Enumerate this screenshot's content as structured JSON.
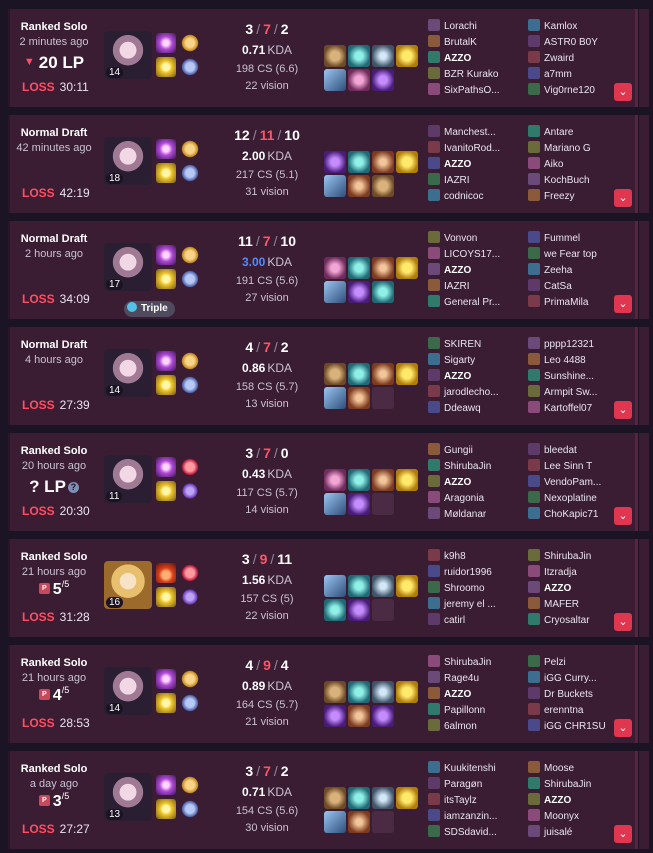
{
  "matches": [
    {
      "mode": "Ranked Solo",
      "ago": "2 minutes ago",
      "lp": {
        "kind": "change",
        "arrow": "▼",
        "text": "20 LP"
      },
      "result": "LOSS",
      "duration": "30:11",
      "champion": {
        "icon": "irelia-portrait-icon",
        "level": "14"
      },
      "spells": [
        "teleport-icon",
        "flash-icon"
      ],
      "runes": [
        "conqueror-icon",
        "resolve-tree-icon"
      ],
      "kills": "3",
      "deaths": "7",
      "assists": "2",
      "kda": "0.71",
      "kda_label": "KDA",
      "kda_color": "#ffffff",
      "cs": "198 CS (6.6)",
      "vision": "22 vision",
      "items": [
        "c0",
        "c1",
        "c2",
        "c3",
        "c4",
        "c5",
        "c6",
        "empty"
      ],
      "team1": [
        "Lorachi",
        "BrutalK",
        "AZZO",
        "BZR Kurako",
        "SixPathsO..."
      ],
      "team2": [
        "Kamlox",
        "ASTR0 B0Y",
        "Zwaird",
        "a7mm",
        "Vig0rne120"
      ]
    },
    {
      "mode": "Normal Draft",
      "ago": "42 minutes ago",
      "lp": {
        "kind": "none"
      },
      "result": "LOSS",
      "duration": "42:19",
      "champion": {
        "icon": "irelia-portrait-icon",
        "level": "18"
      },
      "spells": [
        "teleport-icon",
        "flash-icon"
      ],
      "runes": [
        "conqueror-icon",
        "resolve-tree-icon"
      ],
      "kills": "12",
      "deaths": "11",
      "assists": "10",
      "kda": "2.00",
      "kda_label": "KDA",
      "kda_color": "#ffffff",
      "cs": "217 CS (5.1)",
      "vision": "31 vision",
      "items": [
        "c6",
        "c1",
        "c7",
        "c3",
        "c4",
        "c7",
        "c0",
        "empty"
      ],
      "team1": [
        "Manchest...",
        "IvanitoRod...",
        "AZZO",
        "IAZRI",
        "codnicoc"
      ],
      "team2": [
        "Antare",
        "Mariano G",
        "Aiko",
        "KochBuch",
        "Freezy"
      ]
    },
    {
      "mode": "Normal Draft",
      "ago": "2 hours ago",
      "lp": {
        "kind": "none"
      },
      "multikill": "Triple",
      "result": "LOSS",
      "duration": "34:09",
      "champion": {
        "icon": "irelia-portrait-icon",
        "level": "17"
      },
      "spells": [
        "teleport-icon",
        "flash-icon"
      ],
      "runes": [
        "conqueror-icon",
        "resolve-tree-icon"
      ],
      "kills": "11",
      "deaths": "7",
      "assists": "10",
      "kda": "3.00",
      "kda_label": "KDA",
      "kda_color": "#4f8cff",
      "cs": "191 CS (5.6)",
      "vision": "27 vision",
      "items": [
        "c5",
        "c1",
        "c7",
        "c3",
        "c4",
        "c6",
        "c1",
        "empty"
      ],
      "team1": [
        "Vonvon",
        "LICOYS17...",
        "AZZO",
        "IAZRI",
        "General Pr..."
      ],
      "team2": [
        "Fummel",
        "we Fear top",
        "Zeeha",
        "CatSa",
        "PrimaMila"
      ]
    },
    {
      "mode": "Normal Draft",
      "ago": "4 hours ago",
      "lp": {
        "kind": "none"
      },
      "result": "LOSS",
      "duration": "27:39",
      "champion": {
        "icon": "irelia-portrait-icon",
        "level": "14"
      },
      "spells": [
        "teleport-icon",
        "flash-icon"
      ],
      "runes": [
        "conqueror-icon",
        "resolve-tree-icon"
      ],
      "kills": "4",
      "deaths": "7",
      "assists": "2",
      "kda": "0.86",
      "kda_label": "KDA",
      "kda_color": "#ffffff",
      "cs": "158 CS (5.7)",
      "vision": "13 vision",
      "items": [
        "c0",
        "c1",
        "c7",
        "c3",
        "c4",
        "c7",
        "empty",
        "empty"
      ],
      "team1": [
        "SKIREN",
        "Sigarty",
        "AZZO",
        "jarodlecho...",
        "Ddeawq"
      ],
      "team2": [
        "pppp12321",
        "Leo 4488",
        "Sunshine...",
        "Armpit Sw...",
        "Kartoffel07"
      ]
    },
    {
      "mode": "Ranked Solo",
      "ago": "20 hours ago",
      "lp": {
        "kind": "unknown",
        "text": "? LP",
        "icon": "?"
      },
      "result": "LOSS",
      "duration": "20:30",
      "champion": {
        "icon": "irelia-portrait-icon",
        "level": "11"
      },
      "spells": [
        "teleport-icon",
        "flash-icon"
      ],
      "runes": [
        "electrocute-icon",
        "domination-tree-icon"
      ],
      "kills": "3",
      "deaths": "7",
      "assists": "0",
      "kda": "0.43",
      "kda_label": "KDA",
      "kda_color": "#ffffff",
      "cs": "117 CS (5.7)",
      "vision": "14 vision",
      "items": [
        "c5",
        "c1",
        "c7",
        "c3",
        "c4",
        "c6",
        "empty",
        "empty"
      ],
      "team1": [
        "Gungii",
        "ShirubaJin",
        "AZZO",
        "Aragonia",
        "Møldanar"
      ],
      "team2": [
        "bleedat",
        "Lee Sinn T",
        "VendoPam...",
        "Nexoplatine",
        "ChoKapic71"
      ]
    },
    {
      "mode": "Ranked Solo",
      "ago": "21 hours ago",
      "lp": {
        "kind": "promo",
        "badge": "P",
        "num": "5",
        "den": "/5"
      },
      "result": "LOSS",
      "duration": "31:28",
      "champion": {
        "icon": "lux-portrait-icon",
        "level": "16"
      },
      "spells": [
        "ignite-icon",
        "flash-icon"
      ],
      "runes": [
        "electrocute-icon",
        "domination-tree-icon"
      ],
      "kills": "3",
      "deaths": "9",
      "assists": "11",
      "kda": "1.56",
      "kda_label": "KDA",
      "kda_color": "#ffffff",
      "cs": "157 CS (5)",
      "vision": "22 vision",
      "items": [
        "c4",
        "c1",
        "c2",
        "c3",
        "c1",
        "c6",
        "empty",
        "empty"
      ],
      "team1": [
        "k9h8",
        "ruidor1996",
        "Shroomo",
        "jeremy el ...",
        "catirl"
      ],
      "team2": [
        "ShirubaJin",
        "Itzradja",
        "AZZO",
        "MAFER",
        "Cryosaltar"
      ]
    },
    {
      "mode": "Ranked Solo",
      "ago": "21 hours ago",
      "lp": {
        "kind": "promo",
        "badge": "P",
        "num": "4",
        "den": "/5"
      },
      "result": "LOSS",
      "duration": "28:53",
      "champion": {
        "icon": "irelia-portrait-icon",
        "level": "14"
      },
      "spells": [
        "teleport-icon",
        "flash-icon"
      ],
      "runes": [
        "conqueror-icon",
        "resolve-tree-icon"
      ],
      "kills": "4",
      "deaths": "9",
      "assists": "4",
      "kda": "0.89",
      "kda_label": "KDA",
      "kda_color": "#ffffff",
      "cs": "164 CS (5.7)",
      "vision": "21 vision",
      "items": [
        "c0",
        "c1",
        "c2",
        "c3",
        "c6",
        "c7",
        "c6",
        "empty"
      ],
      "team1": [
        "ShirubaJin",
        "Rage4u",
        "AZZO",
        "Papillonn",
        "6almon"
      ],
      "team2": [
        "Pelzi",
        "iGG Curry...",
        "Dr Buckets",
        "erenntna",
        "iGG CHR1SU"
      ]
    },
    {
      "mode": "Ranked Solo",
      "ago": "a day ago",
      "lp": {
        "kind": "promo",
        "badge": "P",
        "num": "3",
        "den": "/5"
      },
      "result": "LOSS",
      "duration": "27:27",
      "champion": {
        "icon": "irelia-portrait-icon",
        "level": "13"
      },
      "spells": [
        "teleport-icon",
        "flash-icon"
      ],
      "runes": [
        "conqueror-icon",
        "resolve-tree-icon"
      ],
      "kills": "3",
      "deaths": "7",
      "assists": "2",
      "kda": "0.71",
      "kda_label": "KDA",
      "kda_color": "#ffffff",
      "cs": "154 CS (5.6)",
      "vision": "30 vision",
      "items": [
        "c0",
        "c1",
        "c2",
        "c3",
        "c4",
        "c7",
        "empty",
        "empty"
      ],
      "team1": [
        "Kuukitenshi",
        "Paragøn",
        "itsTaylz",
        "iamzanzin...",
        "SDSdavid..."
      ],
      "team2": [
        "Moose",
        "ShirubaJin",
        "AZZO",
        "Moonyx",
        "juisalé"
      ]
    }
  ],
  "player_name": "AZZO",
  "expand_icon": "chevron-down-icon",
  "colors": {
    "loss": "#ff4e64",
    "card": "#3a1d33",
    "background": "#1a1424",
    "expand": "#e0364f"
  }
}
